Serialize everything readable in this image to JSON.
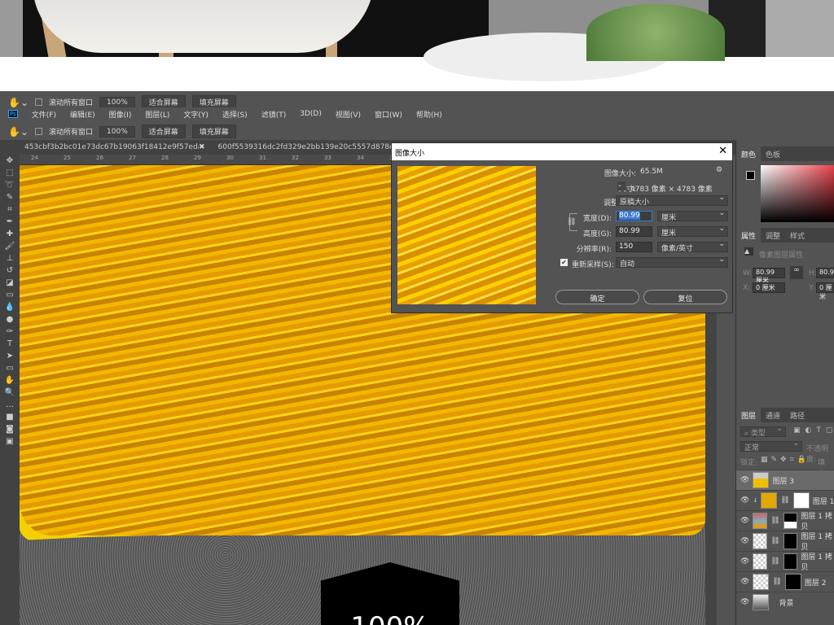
{
  "options_bar": {
    "scroll_all": "滚动所有窗口",
    "zoom": "100%",
    "fit_screen": "适合屏幕",
    "fill_screen": "填充屏幕"
  },
  "menu": {
    "logo": "Ps",
    "items": [
      "文件(F)",
      "编辑(E)",
      "图像(I)",
      "图层(L)",
      "文字(Y)",
      "选择(S)",
      "滤镜(T)",
      "3D(D)",
      "视图(V)",
      "窗口(W)",
      "帮助(H)"
    ]
  },
  "doc_tabs": [
    "453cbf3b2bc01e73dc67b19063f18412e9f57eda-FMnBCl.png",
    "600f5539316dc2fd329e2bb139e20c5557d878e075f55-c"
  ],
  "ruler": [
    "24",
    "25",
    "26",
    "27",
    "28",
    "29",
    "30",
    "31",
    "32",
    "33",
    "34",
    "35"
  ],
  "canvas_text": "100%",
  "dialog": {
    "title": "图像大小",
    "image_size_label": "图像大小:",
    "image_size": "65.5M",
    "dimensions_label": "尺寸:",
    "dimensions": "4783 像素 × 4783 像素",
    "fit_label": "调整为:",
    "fit_value": "原稿大小",
    "width_label": "宽度(D):",
    "width": "80.99",
    "width_unit": "厘米",
    "height_label": "高度(G):",
    "height": "80.99",
    "height_unit": "厘米",
    "resolution_label": "分辨率(R):",
    "resolution": "150",
    "resolution_unit": "像素/英寸",
    "resample_label": "重新采样(S):",
    "resample_checked": true,
    "resample_value": "自动",
    "ok": "确定",
    "reset": "复位"
  },
  "color_panel": {
    "tabs": [
      "颜色",
      "色板"
    ],
    "accent": "#e8404a"
  },
  "properties_panel": {
    "tabs": [
      "属性",
      "调整",
      "样式"
    ],
    "subtitle": "像素图层属性",
    "w_label": "W:",
    "w": "80.99 厘米",
    "h_label": "H:",
    "h": "80.99",
    "x_label": "X:",
    "x": "0 厘米",
    "y_label": "Y:",
    "y": "0 厘米"
  },
  "layers_panel": {
    "tabs": [
      "图层",
      "通道",
      "路径"
    ],
    "filter": "类型",
    "blend": "正常",
    "opacity_label": "不透明度:",
    "lock_label": "锁定:",
    "fill_label": "填充:",
    "layers": [
      {
        "name": "图层 3",
        "selected": true
      },
      {
        "name": "图层 1"
      },
      {
        "name": "图层 1 拷贝"
      },
      {
        "name": "图层 1 拷贝"
      },
      {
        "name": "图层 1 拷贝"
      },
      {
        "name": "图层 2"
      },
      {
        "name": "背景"
      }
    ]
  }
}
